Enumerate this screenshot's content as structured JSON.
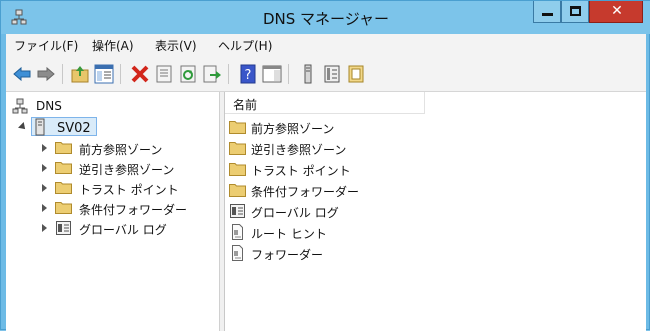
{
  "window": {
    "title": "DNS マネージャー",
    "close_glyph": "✕"
  },
  "menu": [
    "ファイル(F)",
    "操作(A)",
    "表示(V)",
    "ヘルプ(H)"
  ],
  "toolbar": {
    "icons": [
      "back-arrow-icon",
      "forward-arrow-icon",
      "up-folder-icon",
      "show-hide-tree-icon",
      "delete-icon",
      "properties-icon",
      "refresh-icon",
      "export-icon",
      "help-icon",
      "action-pane-icon",
      "server-icon",
      "records-icon",
      "notes-icon"
    ]
  },
  "tree": {
    "root": "DNS",
    "server": "SV02",
    "children": [
      "前方参照ゾーン",
      "逆引き参照ゾーン",
      "トラスト ポイント",
      "条件付フォワーダー",
      "グローバル ログ"
    ]
  },
  "list": {
    "column_header": "名前",
    "items": [
      {
        "label": "前方参照ゾーン",
        "icon": "folder-icon"
      },
      {
        "label": "逆引き参照ゾーン",
        "icon": "folder-icon"
      },
      {
        "label": "トラスト ポイント",
        "icon": "folder-icon"
      },
      {
        "label": "条件付フォワーダー",
        "icon": "folder-icon"
      },
      {
        "label": "グローバル ログ",
        "icon": "log-icon"
      },
      {
        "label": "ルート ヒント",
        "icon": "document-icon"
      },
      {
        "label": "フォワーダー",
        "icon": "document-icon"
      }
    ]
  },
  "colors": {
    "titlebar": "#7cc4ea",
    "close_button": "#c63a2d",
    "selection": "#d9ebf9",
    "folder": "#e8c66a"
  }
}
